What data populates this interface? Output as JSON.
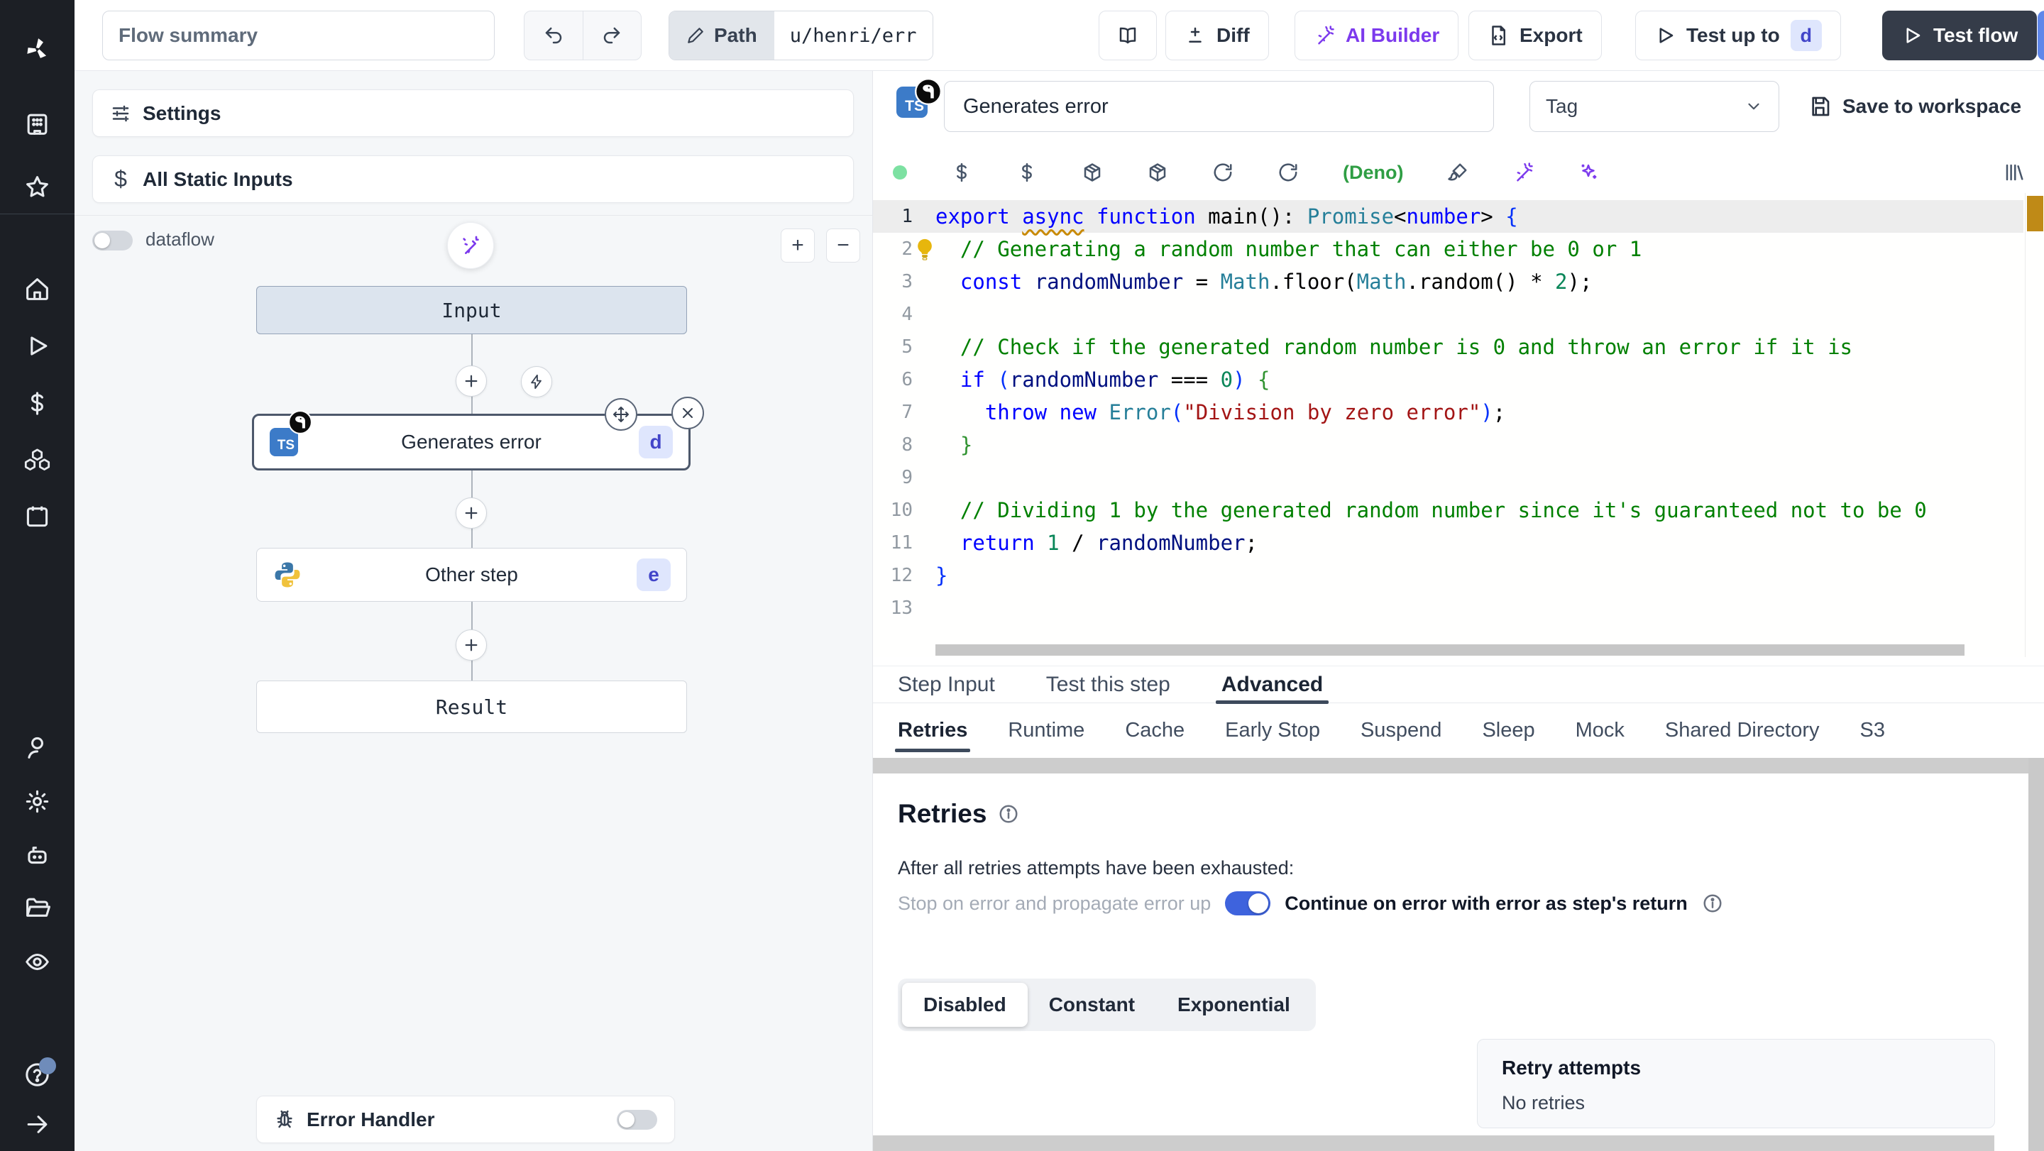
{
  "colors": {
    "accent": "#3e63dd",
    "ai-purple": "#7c3aed",
    "deno-green": "#2f9e44",
    "badge-bg": "#dfe6fd",
    "badge-text": "#4245c9",
    "status-green": "#7de1a2",
    "selected-node": "#4d586b",
    "marker-gold": "#bf8a17"
  },
  "header": {
    "flow_summary_placeholder": "Flow summary",
    "path_label": "Path",
    "path_value": "u/henri/err",
    "diff_label": "Diff",
    "ai_builder_label": "AI Builder",
    "export_label": "Export",
    "test_up_to_label": "Test up to",
    "test_up_to_badge": "d",
    "test_flow_label": "Test flow"
  },
  "flow_panel": {
    "settings_label": "Settings",
    "static_inputs_label": "All Static Inputs",
    "static_inputs_icon": "$",
    "dataflow_label": "dataflow",
    "zoom_in_label": "+",
    "zoom_out_label": "−",
    "nodes": {
      "input_label": "Input",
      "generates_error": {
        "label": "Generates error",
        "lang": "TS",
        "badge": "d"
      },
      "other_step": {
        "label": "Other step",
        "badge": "e"
      },
      "result_label": "Result"
    },
    "error_handler_label": "Error Handler"
  },
  "step_editor": {
    "lang_badge": "TS",
    "name_value": "Generates error",
    "tag_placeholder": "Tag",
    "save_label": "Save to workspace",
    "runtime_label": "(Deno)"
  },
  "tabs": {
    "items": [
      "Step Input",
      "Test this step",
      "Advanced"
    ],
    "active_index": 2
  },
  "advanced_tabs": {
    "items": [
      "Retries",
      "Runtime",
      "Cache",
      "Early Stop",
      "Suspend",
      "Sleep",
      "Mock",
      "Shared Directory",
      "S3"
    ],
    "active_index": 0
  },
  "retries": {
    "heading": "Retries",
    "exhausted_text": "After all retries attempts have been exhausted:",
    "stop_label": "Stop on error and propagate error up",
    "continue_label": "Continue on error with error as step's return",
    "modes": {
      "items": [
        "Disabled",
        "Constant",
        "Exponential"
      ],
      "active_index": 0
    },
    "retry_attempts_label": "Retry attempts",
    "retry_attempts_value": "No retries"
  },
  "code": {
    "lines": [
      {
        "n": 1,
        "active": true,
        "t": [
          [
            "kw",
            "export "
          ],
          [
            "kwa",
            "async"
          ],
          [
            "kw",
            " function "
          ],
          [
            "pl",
            "main"
          ],
          [
            "pl",
            "(): "
          ],
          [
            "ty",
            "Promise"
          ],
          [
            "pl",
            "<"
          ],
          [
            "kw",
            "number"
          ],
          [
            "pl",
            "> "
          ],
          [
            "b1",
            "{"
          ]
        ]
      },
      {
        "n": 2,
        "bulb": true,
        "t": [
          [
            "pl",
            "  "
          ],
          [
            "cm",
            "// Generating a random number that can either be 0 or 1"
          ]
        ]
      },
      {
        "n": 3,
        "t": [
          [
            "pl",
            "  "
          ],
          [
            "kw",
            "const "
          ],
          [
            "vr",
            "randomNumber"
          ],
          [
            "pl",
            " = "
          ],
          [
            "ty",
            "Math"
          ],
          [
            "pl",
            ".floor("
          ],
          [
            "ty",
            "Math"
          ],
          [
            "pl",
            ".random() * "
          ],
          [
            "nu",
            "2"
          ],
          [
            "pl",
            ");"
          ]
        ]
      },
      {
        "n": 4,
        "t": []
      },
      {
        "n": 5,
        "t": [
          [
            "pl",
            "  "
          ],
          [
            "cm",
            "// Check if the generated random number is 0 and throw an error if it is"
          ]
        ]
      },
      {
        "n": 6,
        "t": [
          [
            "pl",
            "  "
          ],
          [
            "kw",
            "if "
          ],
          [
            "b1",
            "("
          ],
          [
            "vr",
            "randomNumber"
          ],
          [
            "pl",
            " === "
          ],
          [
            "nu",
            "0"
          ],
          [
            "b1",
            ")"
          ],
          [
            "pl",
            " "
          ],
          [
            "b2",
            "{"
          ]
        ]
      },
      {
        "n": 7,
        "t": [
          [
            "pl",
            "    "
          ],
          [
            "kw",
            "throw"
          ],
          [
            "pl",
            " "
          ],
          [
            "kw",
            "new"
          ],
          [
            "pl",
            " "
          ],
          [
            "ty",
            "Error"
          ],
          [
            "b1",
            "("
          ],
          [
            "st",
            "\"Division by zero error\""
          ],
          [
            "b1",
            ")"
          ],
          [
            "pl",
            ";"
          ]
        ]
      },
      {
        "n": 8,
        "t": [
          [
            "pl",
            "  "
          ],
          [
            "b2",
            "}"
          ]
        ]
      },
      {
        "n": 9,
        "t": []
      },
      {
        "n": 10,
        "t": [
          [
            "pl",
            "  "
          ],
          [
            "cm",
            "// Dividing 1 by the generated random number since it's guaranteed not to be 0"
          ]
        ]
      },
      {
        "n": 11,
        "t": [
          [
            "pl",
            "  "
          ],
          [
            "kw",
            "return "
          ],
          [
            "nu",
            "1"
          ],
          [
            "pl",
            " / "
          ],
          [
            "vr",
            "randomNumber"
          ],
          [
            "pl",
            ";"
          ]
        ]
      },
      {
        "n": 12,
        "t": [
          [
            "b1",
            "}"
          ]
        ]
      },
      {
        "n": 13,
        "t": []
      }
    ]
  }
}
